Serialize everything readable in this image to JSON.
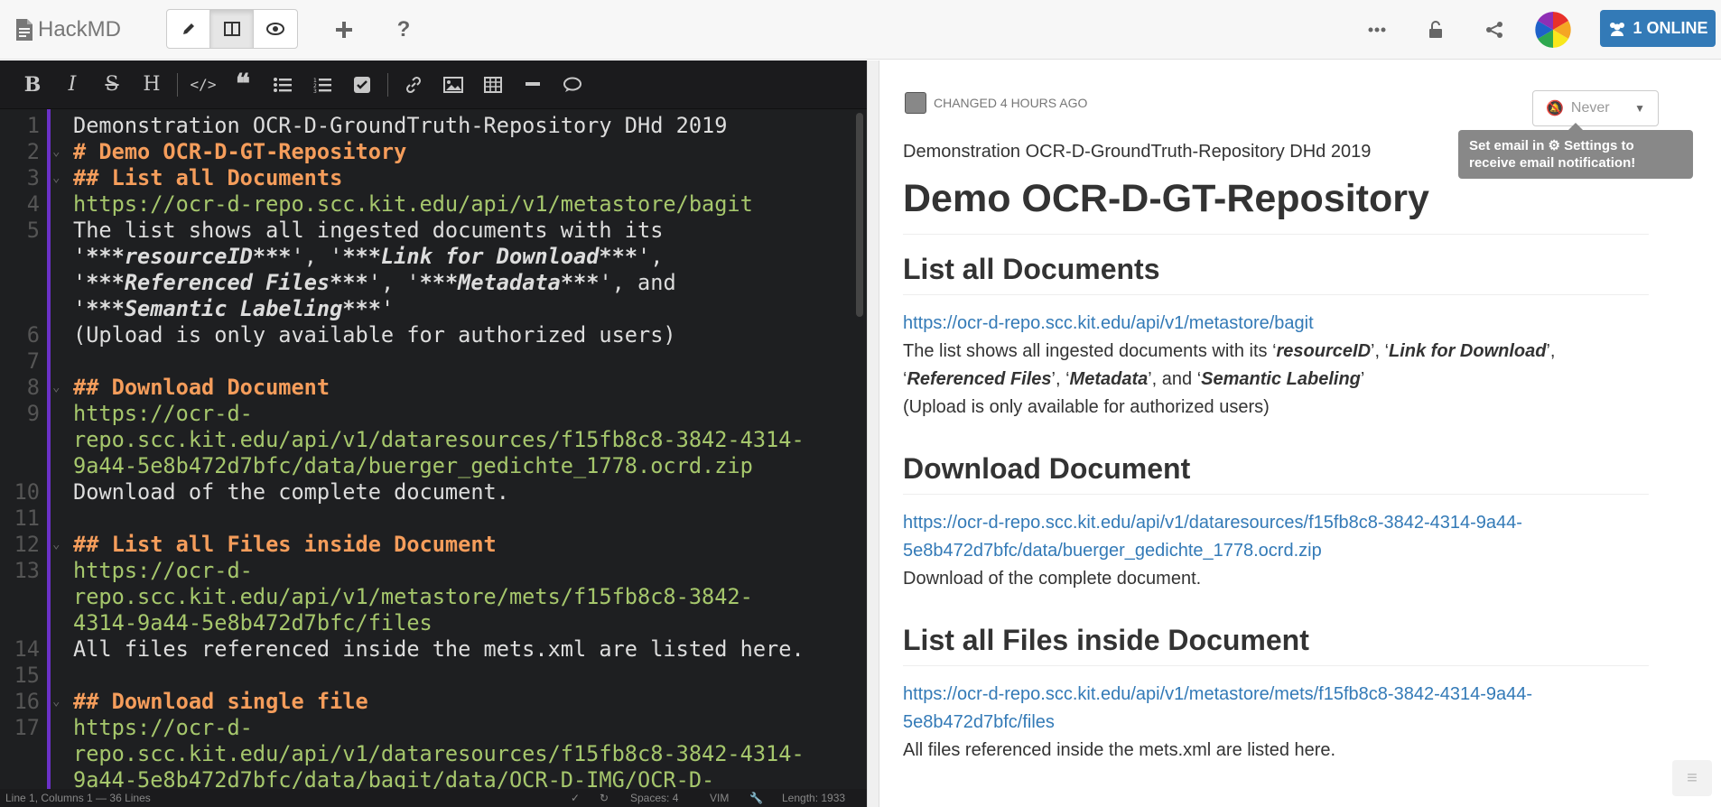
{
  "app": {
    "brand": "HackMD",
    "online_label": "1 ONLINE"
  },
  "toolbar_icons": [
    "bold-icon",
    "italic-icon",
    "strikethrough-icon",
    "heading-icon",
    "code-icon",
    "quote-icon",
    "unordered-list-icon",
    "ordered-list-icon",
    "checklist-icon",
    "link-icon",
    "image-icon",
    "table-icon",
    "horizontal-rule-icon",
    "comment-icon"
  ],
  "editor": {
    "lines": [
      {
        "n": "1",
        "segments": [
          {
            "t": "Demonstration OCR-D-GroundTruth-Repository DHd 2019",
            "c": ""
          }
        ]
      },
      {
        "n": "2",
        "fold": true,
        "segments": [
          {
            "t": "# Demo OCR-D-GT-Repository",
            "c": "h"
          }
        ]
      },
      {
        "n": "3",
        "fold": true,
        "segments": [
          {
            "t": "## List all Documents",
            "c": "h"
          }
        ]
      },
      {
        "n": "4",
        "segments": [
          {
            "t": "https://ocr-d-repo.scc.kit.edu/api/v1/metastore/bagit",
            "c": "u"
          }
        ]
      },
      {
        "n": "5",
        "segments": [
          {
            "t": "The list shows all ingested documents with its",
            "c": ""
          }
        ]
      },
      {
        "n": "",
        "segments": [
          {
            "t": "'",
            "c": ""
          },
          {
            "t": "***resourceID***",
            "c": "b"
          },
          {
            "t": "', '",
            "c": ""
          },
          {
            "t": "***Link for Download***",
            "c": "b"
          },
          {
            "t": "',",
            "c": ""
          }
        ]
      },
      {
        "n": "",
        "segments": [
          {
            "t": "'",
            "c": ""
          },
          {
            "t": "***Referenced Files***",
            "c": "b"
          },
          {
            "t": "', '",
            "c": ""
          },
          {
            "t": "***Metadata***",
            "c": "b"
          },
          {
            "t": "', and",
            "c": ""
          }
        ]
      },
      {
        "n": "",
        "segments": [
          {
            "t": "'",
            "c": ""
          },
          {
            "t": "***Semantic Labeling***",
            "c": "b"
          },
          {
            "t": "'",
            "c": ""
          }
        ]
      },
      {
        "n": "6",
        "segments": [
          {
            "t": "(Upload is only available for authorized users)",
            "c": ""
          }
        ]
      },
      {
        "n": "7",
        "segments": [
          {
            "t": "",
            "c": ""
          }
        ]
      },
      {
        "n": "8",
        "fold": true,
        "segments": [
          {
            "t": "## Download Document",
            "c": "h"
          }
        ]
      },
      {
        "n": "9",
        "segments": [
          {
            "t": "https://ocr-d-",
            "c": "u"
          }
        ]
      },
      {
        "n": "",
        "segments": [
          {
            "t": "repo.scc.kit.edu/api/v1/dataresources/f15fb8c8-3842-4314-",
            "c": "u"
          }
        ]
      },
      {
        "n": "",
        "segments": [
          {
            "t": "9a44-5e8b472d7bfc/data/buerger_gedichte_1778.ocrd.zip",
            "c": "u"
          }
        ]
      },
      {
        "n": "10",
        "segments": [
          {
            "t": "Download of the complete document.",
            "c": ""
          }
        ]
      },
      {
        "n": "11",
        "segments": [
          {
            "t": "",
            "c": ""
          }
        ]
      },
      {
        "n": "12",
        "fold": true,
        "segments": [
          {
            "t": "## List all Files inside Document",
            "c": "h"
          }
        ]
      },
      {
        "n": "13",
        "segments": [
          {
            "t": "https://ocr-d-",
            "c": "u"
          }
        ]
      },
      {
        "n": "",
        "segments": [
          {
            "t": "repo.scc.kit.edu/api/v1/metastore/mets/f15fb8c8-3842-",
            "c": "u"
          }
        ]
      },
      {
        "n": "",
        "segments": [
          {
            "t": "4314-9a44-5e8b472d7bfc/files",
            "c": "u"
          }
        ]
      },
      {
        "n": "14",
        "segments": [
          {
            "t": "All files referenced inside the mets.xml are listed here.",
            "c": ""
          }
        ]
      },
      {
        "n": "15",
        "segments": [
          {
            "t": "",
            "c": ""
          }
        ]
      },
      {
        "n": "16",
        "fold": true,
        "segments": [
          {
            "t": "## Download single file",
            "c": "h"
          }
        ]
      },
      {
        "n": "17",
        "segments": [
          {
            "t": "https://ocr-d-",
            "c": "u"
          }
        ]
      },
      {
        "n": "",
        "segments": [
          {
            "t": "repo.scc.kit.edu/api/v1/dataresources/f15fb8c8-3842-4314-",
            "c": "u"
          }
        ]
      },
      {
        "n": "",
        "segments": [
          {
            "t": "9a44-5e8b472d7bfc/data/bagit/data/OCR-D-IMG/OCR-D-",
            "c": "u"
          }
        ]
      }
    ],
    "status": {
      "position": "Line 1, Columns 1 — 36 Lines",
      "spaces": "Spaces: 4",
      "mode": "VIM",
      "length": "Length: 1933"
    }
  },
  "view": {
    "changed": "CHANGED 4 HOURS AGO",
    "notify": "Never",
    "tooltip": "Set email in ⚙ Settings to receive email notification!",
    "intro": "Demonstration OCR-D-GroundTruth-Repository DHd 2019",
    "title": "Demo OCR-D-GT-Repository",
    "s1": {
      "heading": "List all Documents",
      "link": "https://ocr-d-repo.scc.kit.edu/api/v1/metastore/bagit",
      "text_a": "The list shows all ingested documents with its ‘",
      "b1": "resourceID",
      "text_b": "’, ‘",
      "b2": "Link for Download",
      "text_c": "’,",
      "text_d": "‘",
      "b3": "Referenced Files",
      "text_e": "’, ‘",
      "b4": "Metadata",
      "text_f": "’, and ‘",
      "b5": "Semantic Labeling",
      "text_g": "’",
      "note": "(Upload is only available for authorized users)"
    },
    "s2": {
      "heading": "Download Document",
      "link_a": "https://ocr-d-repo.scc.kit.edu/api/v1/dataresources/f15fb8c8-3842-4314-9a44-",
      "link_b": "5e8b472d7bfc/data/buerger_gedichte_1778.ocrd.zip",
      "text": "Download of the complete document."
    },
    "s3": {
      "heading": "List all Files inside Document",
      "link_a": "https://ocr-d-repo.scc.kit.edu/api/v1/metastore/mets/f15fb8c8-3842-4314-9a44-",
      "link_b": "5e8b472d7bfc/files",
      "text": "All files referenced inside the mets.xml are listed here."
    }
  },
  "colors": {
    "accent": "#337ab7",
    "heading_md": "#f59d5b",
    "url_md": "#a6c76c",
    "gutter": "#6b31c7"
  }
}
